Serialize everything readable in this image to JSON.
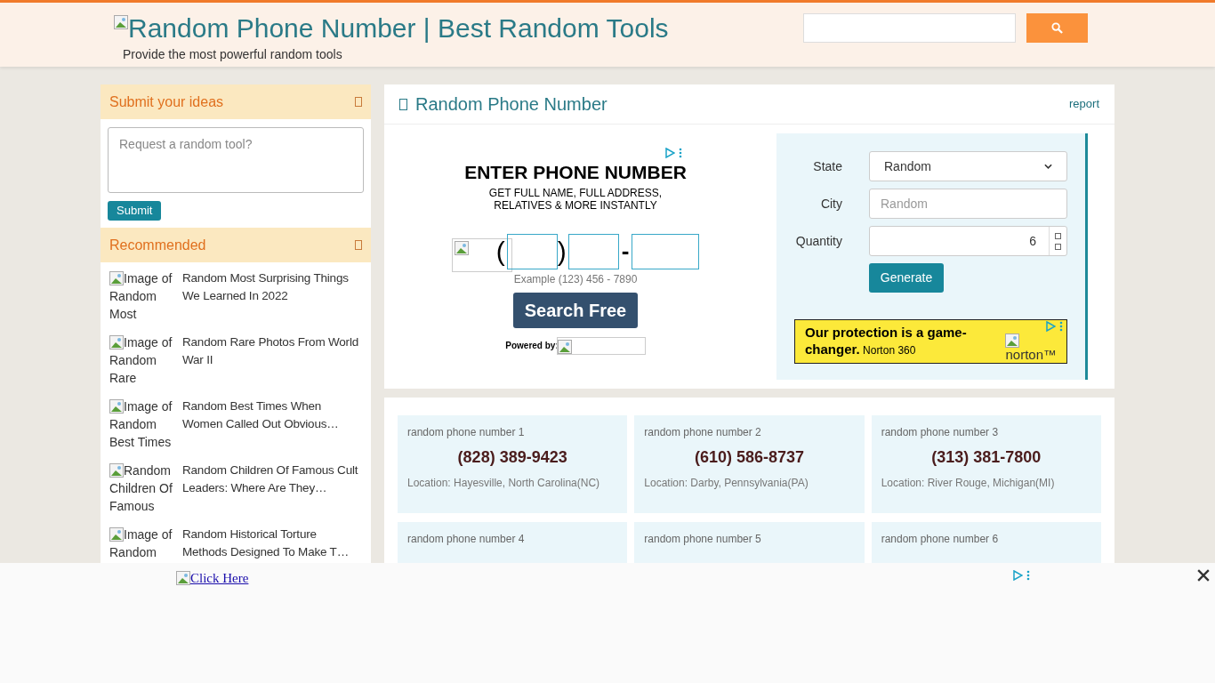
{
  "header": {
    "logo_alt": "Random Phone Number | Best Random Tools",
    "tagline": "Provide the most powerful random tools"
  },
  "sidebar": {
    "ideas": {
      "title": "Submit your ideas",
      "placeholder": "Request a random tool?",
      "button": "Submit"
    },
    "recommended": {
      "title": "Recommended",
      "items": [
        {
          "image_alt": "Image of Random Most",
          "title": "Random Most Surprising Things We Learned In 2022"
        },
        {
          "image_alt": "Image of Random Rare",
          "title": "Random Rare Photos From World War II"
        },
        {
          "image_alt": "Image of Random Best Times",
          "title": "Random Best Times When Women Called Out Obvious…"
        },
        {
          "image_alt": "Random Children Of Famous",
          "title": "Random Children Of Famous Cult Leaders: Where Are They…"
        },
        {
          "image_alt": "Image of Random",
          "title": "Random Historical Torture Methods Designed To Make T…"
        }
      ]
    }
  },
  "tool": {
    "title": "Random Phone Number",
    "report": "report",
    "ad": {
      "heading": "ENTER PHONE NUMBER",
      "sublines": [
        "GET FULL NAME, FULL ADDRESS,",
        "RELATIVES & MORE INSTANTLY"
      ],
      "open_paren": "(",
      "close_paren": ")",
      "dash": "-",
      "example": "Example (123) 456 - 7890",
      "button": "Search Free",
      "powered_by": "Powered by:"
    },
    "form": {
      "state_label": "State",
      "state_value": "Random",
      "city_label": "City",
      "city_placeholder": "Random",
      "quantity_label": "Quantity",
      "quantity_value": "6",
      "button": "Generate"
    },
    "banner": {
      "text": "**Our protection is a game-changer.** Norton 360",
      "image_alt": "norton™"
    }
  },
  "results": [
    {
      "label": "random phone number 1",
      "number": "(828) 389-9423",
      "location": "Location: Hayesville, North Carolina(NC)"
    },
    {
      "label": "random phone number 2",
      "number": "(610) 586-8737",
      "location": "Location: Darby, Pennsylvania(PA)"
    },
    {
      "label": "random phone number 3",
      "number": "(313) 381-7800",
      "location": "Location: River Rouge, Michigan(MI)"
    },
    {
      "label": "random phone number 4"
    },
    {
      "label": "random phone number 5"
    },
    {
      "label": "random phone number 6"
    }
  ],
  "bottom_ad": {
    "link": "Click Here"
  }
}
